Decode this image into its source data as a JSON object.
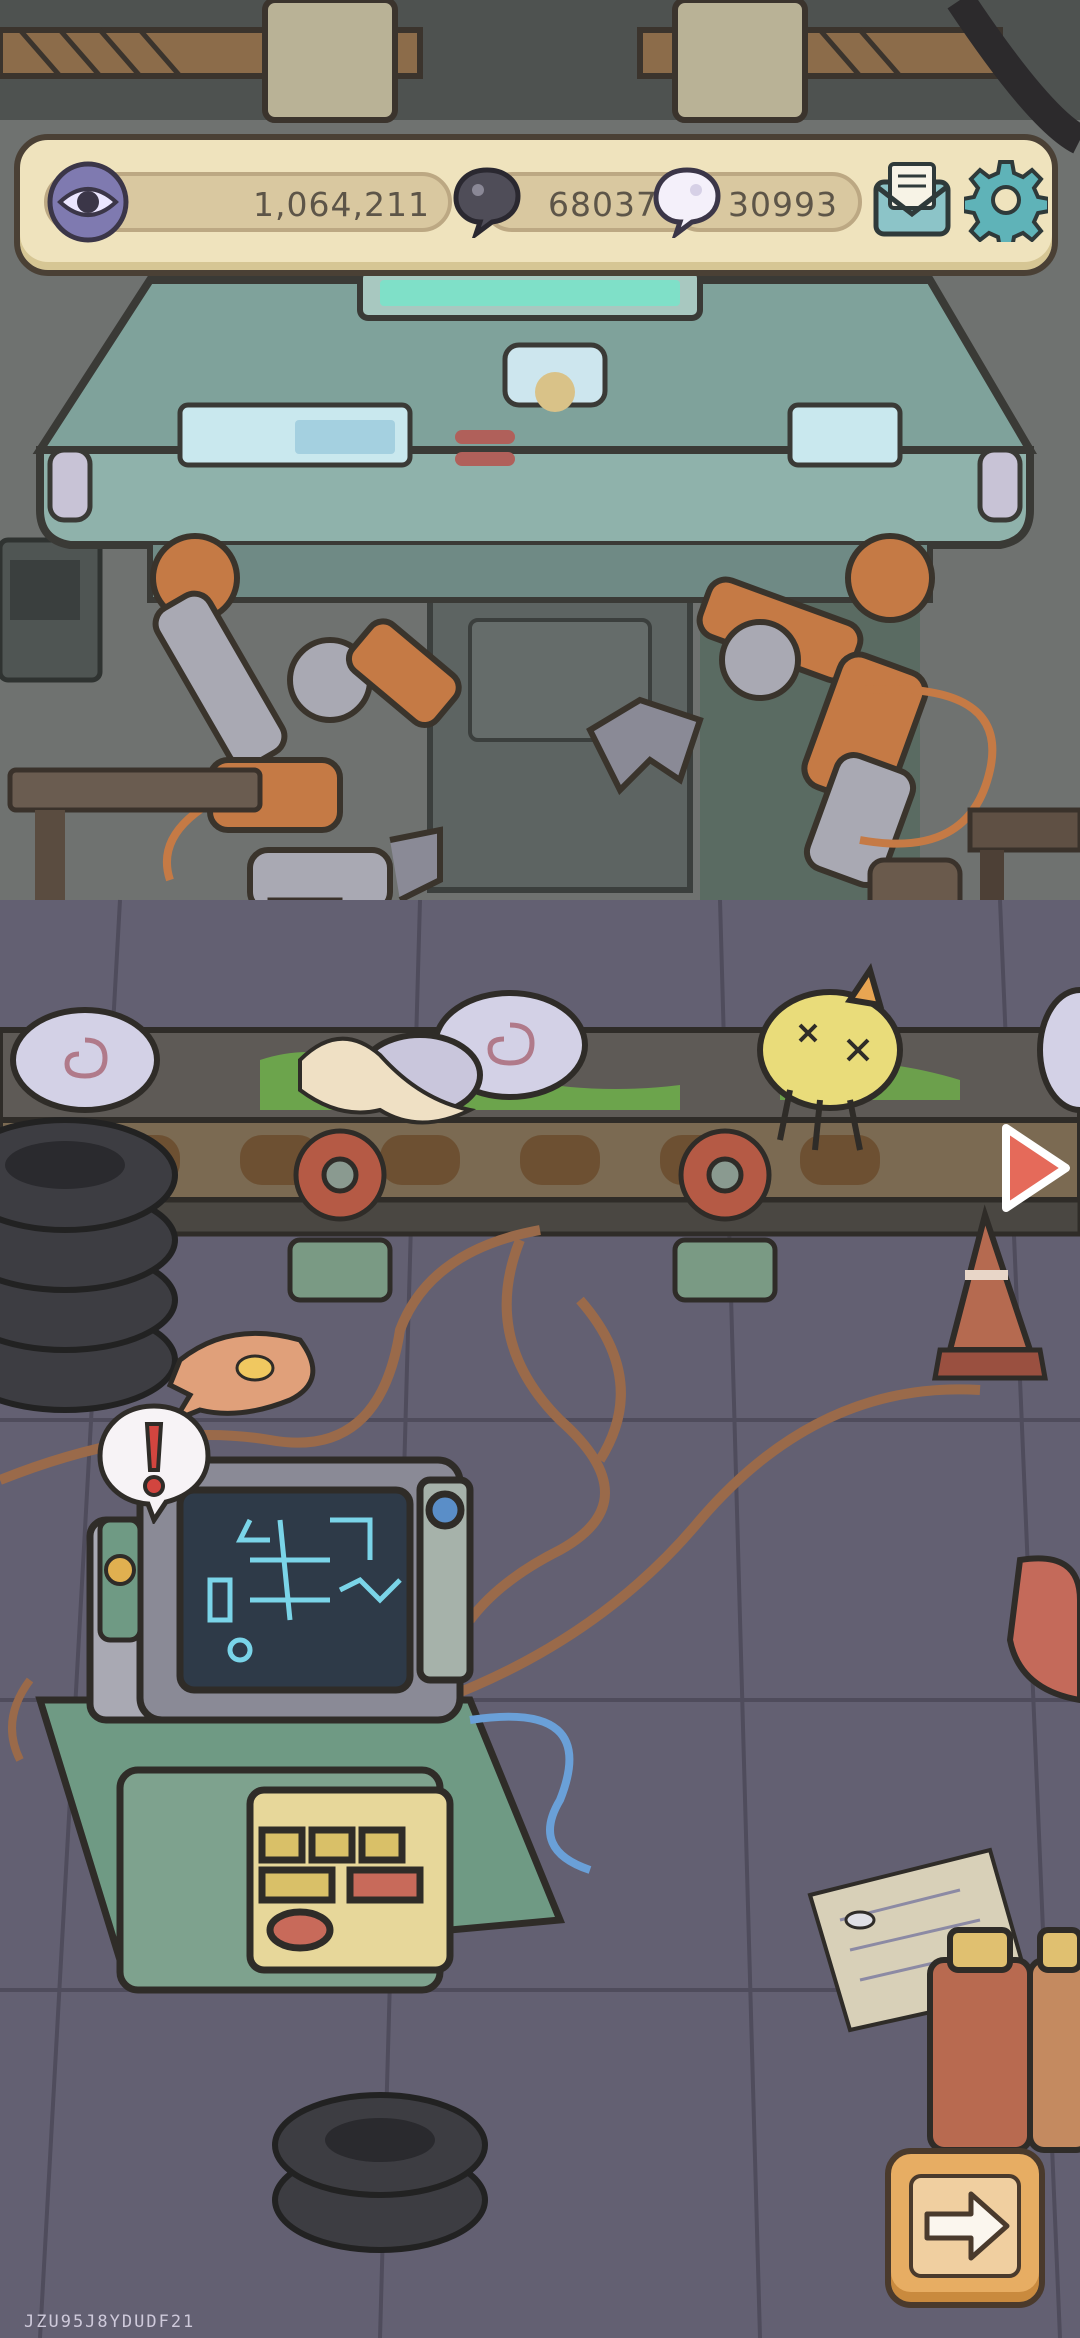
{
  "hud": {
    "views": "1,064,211",
    "dark_bubbles": "68037",
    "light_bubbles": "30993"
  },
  "icons": {
    "views": "eye-icon",
    "dark_bubble": "dark-speech-bubble-icon",
    "light_bubble": "light-speech-bubble-icon",
    "mail": "mail-icon",
    "settings": "gear-icon",
    "next": "arrow-right-icon",
    "side": "triangle-right-icon",
    "alert": "exclamation-icon"
  },
  "colors": {
    "hud_bg": "#efe3bd",
    "hud_border": "#4a4035",
    "accent_teal": "#5a9a9a",
    "floor": "#5f5a6b"
  },
  "footer": {
    "device_id": "JZU95J8YDUDF21"
  }
}
